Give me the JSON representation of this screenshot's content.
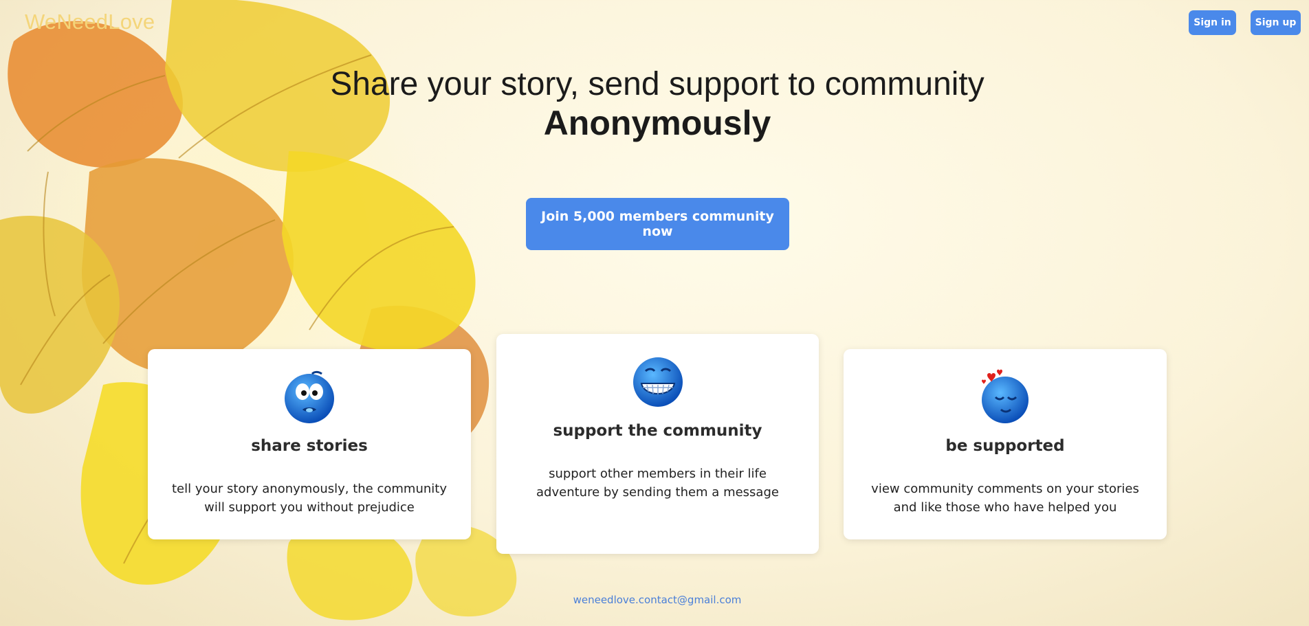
{
  "header": {
    "logo": "WeNeedLove",
    "sign_in_label": "Sign in",
    "sign_up_label": "Sign up"
  },
  "hero": {
    "title_line1": "Share your story, send support to community",
    "title_line2": "Anonymously",
    "cta_label": "Join 5,000 members community now"
  },
  "features": [
    {
      "icon": "worried-blue-smiley-icon",
      "title": "share stories",
      "description": "tell your story anonymously, the community will support you without prejudice"
    },
    {
      "icon": "grinning-blue-smiley-icon",
      "title": "support the community",
      "description": "support other members in their life adventure by sending them a message"
    },
    {
      "icon": "in-love-blue-smiley-icon",
      "title": "be supported",
      "description": "view community comments on your stories and like those who have helped you"
    }
  ],
  "footer": {
    "email": "weneedlove.contact@gmail.com"
  },
  "colors": {
    "accent": "#4a89ea",
    "logo": "#f4d57a",
    "background": "#fbf3d9",
    "leaf_yellow": "#f2d023",
    "leaf_orange": "#e39a2f"
  }
}
